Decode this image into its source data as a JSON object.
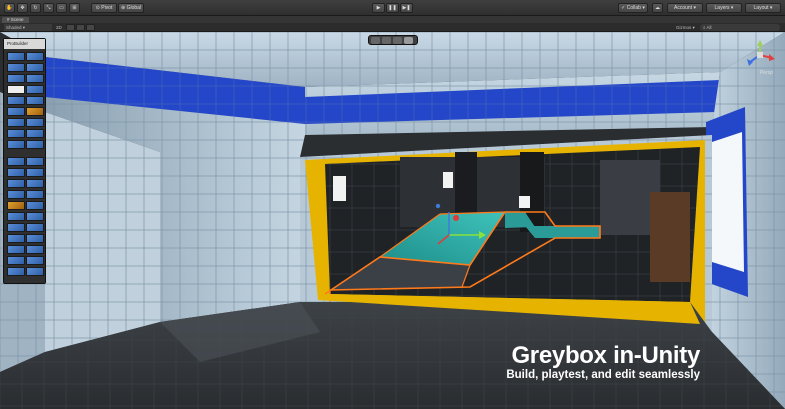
{
  "toolbar": {
    "pivot_label": "Pivot",
    "global_label": "Global",
    "collab_label": "Collab",
    "account_label": "Account",
    "layers_label": "Layers",
    "layout_label": "Layout",
    "icons": [
      "hand-icon",
      "move-icon",
      "rotate-icon",
      "scale-icon",
      "rect-icon",
      "transform-icon"
    ]
  },
  "scene": {
    "tab_label": "Scene",
    "shading_label": "Shaded",
    "mode_2d_label": "2D",
    "gizmos_label": "Gizmos",
    "search_placeholder": "All"
  },
  "probuilder": {
    "title": "ProBuilder"
  },
  "gizmo": {
    "label": "Persp"
  },
  "caption": {
    "title": "Greybox in-Unity",
    "subtitle": "Build, playtest, and edit seamlessly"
  },
  "colors": {
    "accent_blue": "#2446c8",
    "selection_orange": "#ff8c00",
    "highlight_yellow": "#e6b400",
    "face_teal": "#26a6a0"
  }
}
